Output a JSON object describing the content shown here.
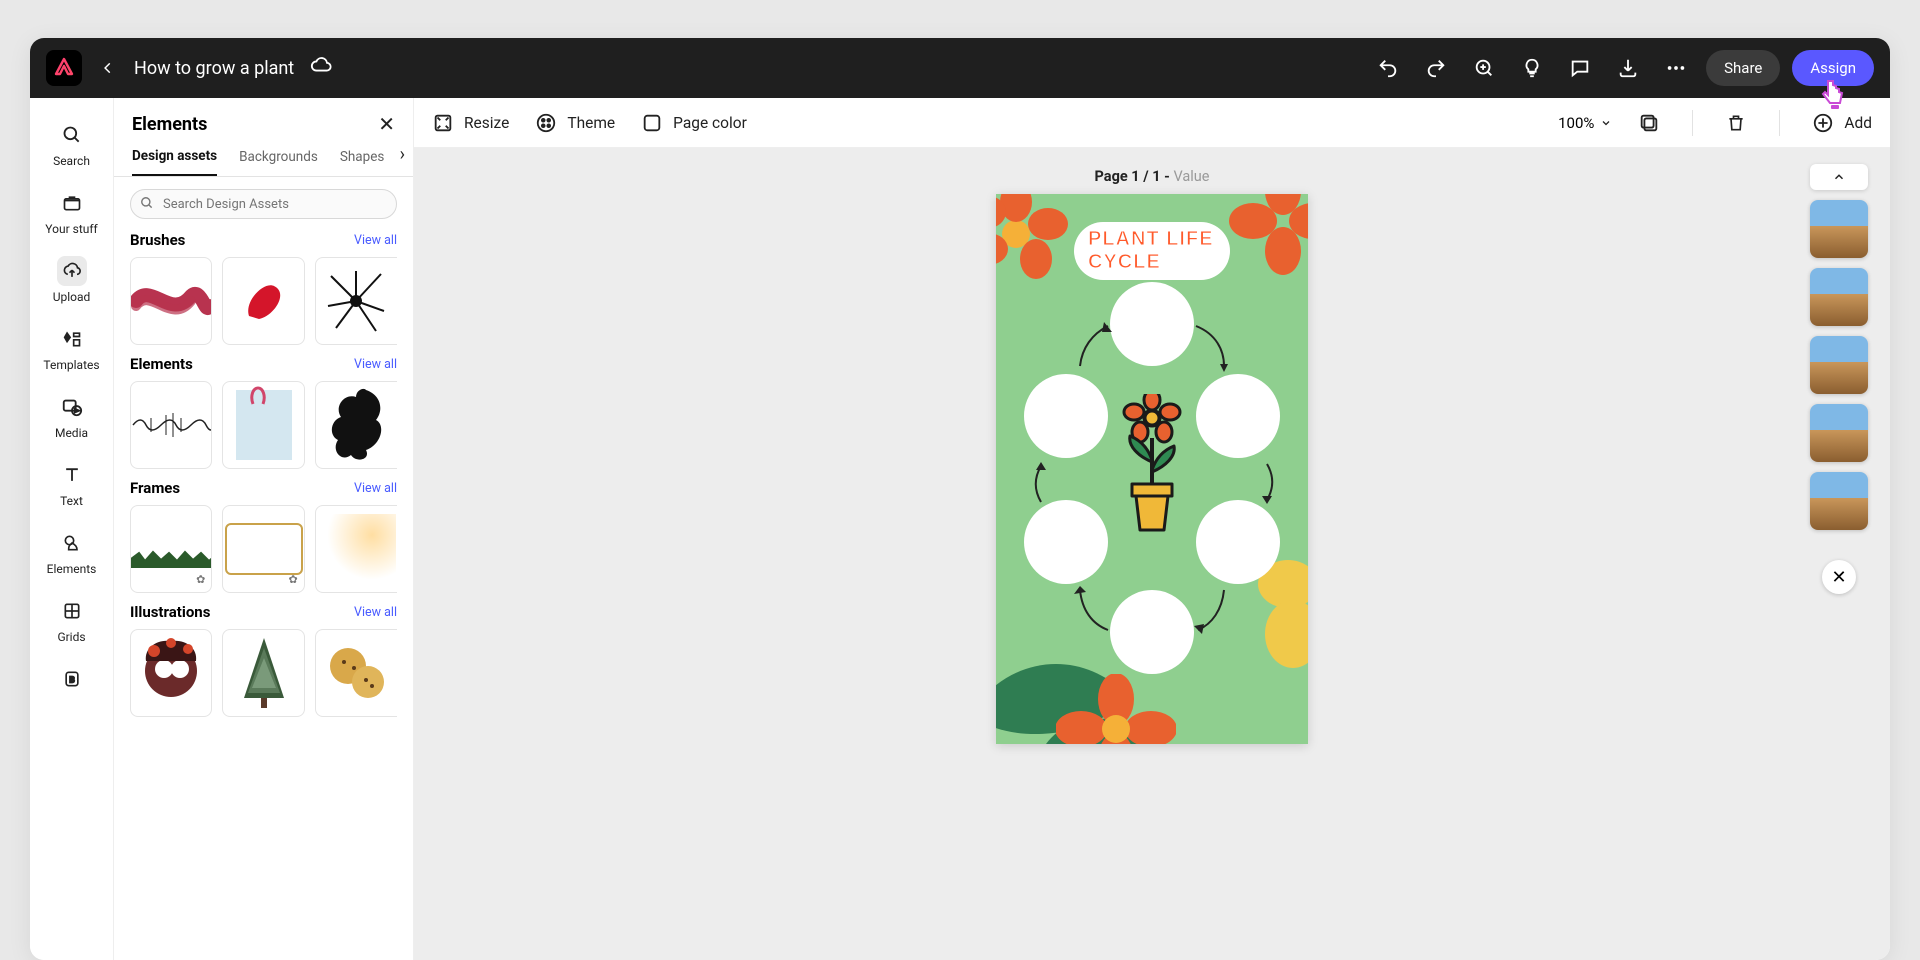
{
  "header": {
    "doc_title": "How to grow a plant",
    "share_label": "Share",
    "assign_label": "Assign"
  },
  "rail": {
    "items": [
      {
        "label": "Search"
      },
      {
        "label": "Your stuff"
      },
      {
        "label": "Upload"
      },
      {
        "label": "Templates"
      },
      {
        "label": "Media"
      },
      {
        "label": "Text"
      },
      {
        "label": "Elements"
      },
      {
        "label": "Grids"
      }
    ]
  },
  "panel": {
    "title": "Elements",
    "tabs": [
      "Design assets",
      "Backgrounds",
      "Shapes"
    ],
    "search_placeholder": "Search Design Assets",
    "view_all": "View all",
    "sections": {
      "brushes": "Brushes",
      "elements": "Elements",
      "frames": "Frames",
      "illustrations": "Illustrations"
    }
  },
  "actions": {
    "resize": "Resize",
    "theme": "Theme",
    "page_color": "Page color",
    "zoom": "100%",
    "add": "Add"
  },
  "canvas": {
    "page_label_bold": "Page 1 / 1 - ",
    "page_label_faded": "Value",
    "artboard_title": "PLANT LIFE CYCLE"
  }
}
